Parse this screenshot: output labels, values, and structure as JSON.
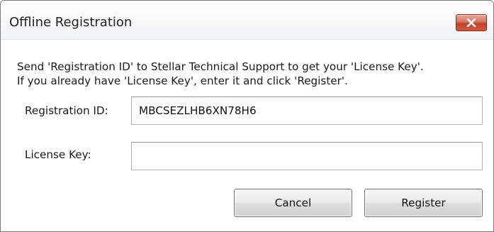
{
  "window": {
    "title": "Offline Registration",
    "close_icon": "close-x-icon"
  },
  "instruction": {
    "line1": "Send 'Registration ID' to Stellar Technical Support to get your 'License Key'.",
    "line2": "If you already have 'License Key', enter it and click 'Register'."
  },
  "fields": {
    "registration_id": {
      "label": "Registration ID:",
      "value": "MBCSEZLHB6XN78H6"
    },
    "license_key": {
      "label": "License Key:",
      "value": ""
    }
  },
  "buttons": {
    "cancel_label": "Cancel",
    "register_label": "Register"
  },
  "colors": {
    "close_button": "#c4412a",
    "title_bar": "#f1f4f7",
    "field_border": "#a9b3bf"
  }
}
